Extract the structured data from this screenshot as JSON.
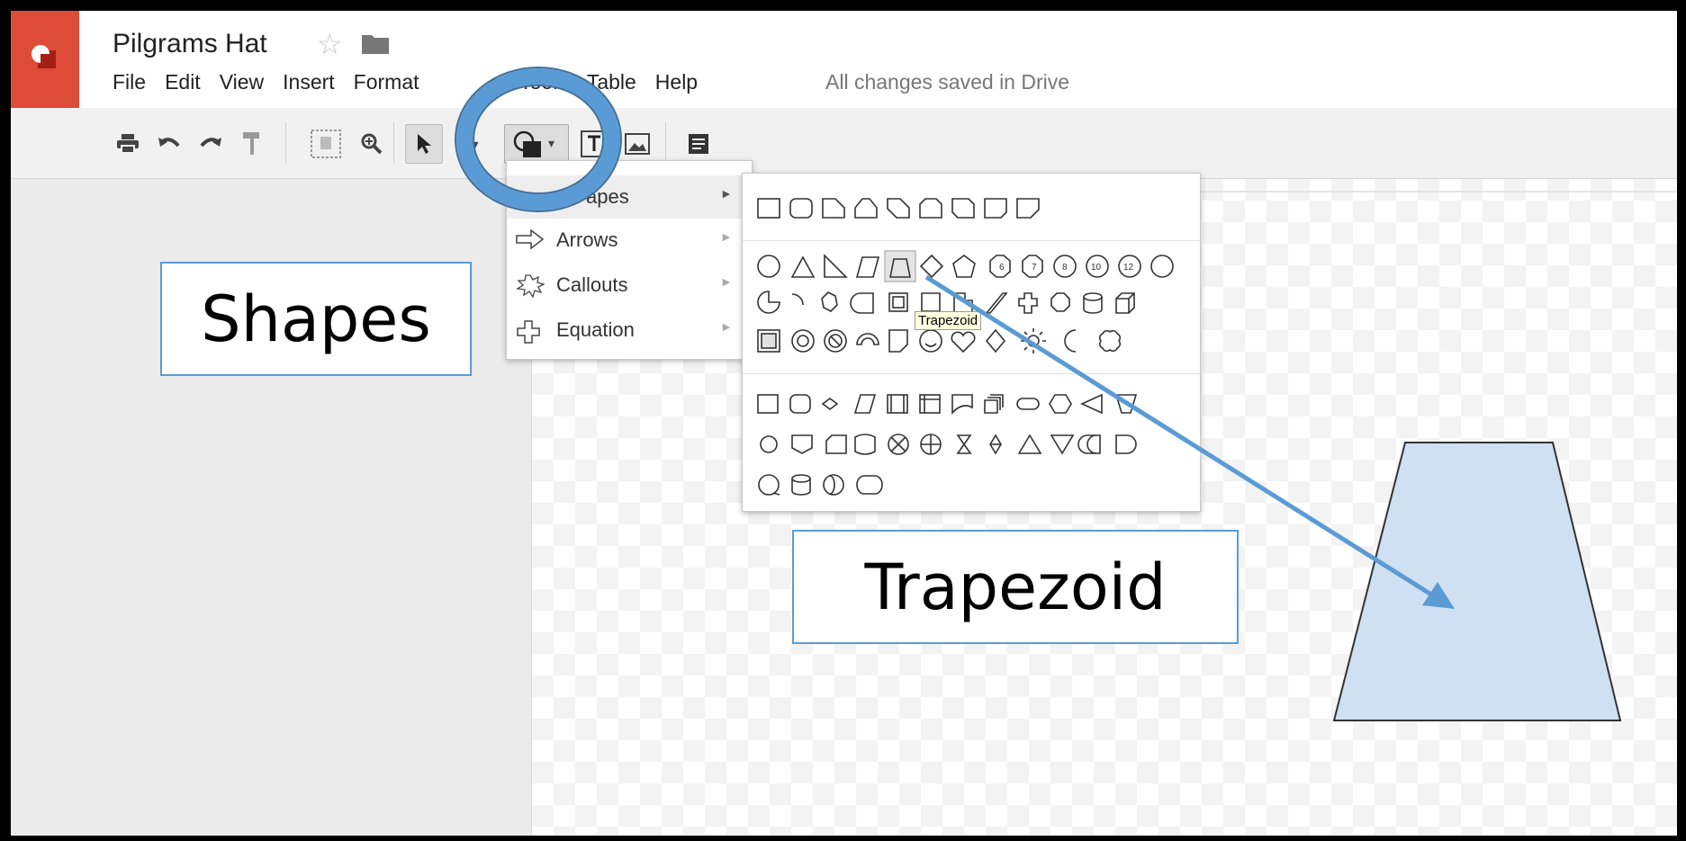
{
  "app": {
    "doc_title": "Pilgrams Hat",
    "saved_status": "All changes saved in Drive",
    "brand_color": "#dd4b39"
  },
  "menubar": {
    "items": [
      "File",
      "Edit",
      "View",
      "Insert",
      "Format",
      "",
      "Tools",
      "Table",
      "Help"
    ],
    "visible_fragments": {
      "arrange": "ge",
      "tools": "Tools"
    }
  },
  "toolbar": {
    "icons": [
      "print-icon",
      "undo-icon",
      "redo-icon",
      "paint-format-icon",
      "fit-icon",
      "zoom-icon",
      "select-icon",
      "line-icon",
      "shape-icon",
      "textbox-icon",
      "image-icon",
      "comment-icon"
    ]
  },
  "shape_menu": {
    "items": [
      {
        "label": "Shapes",
        "visible_label": "apes",
        "icon": "shapes-icon"
      },
      {
        "label": "Arrows",
        "icon": "arrow-icon"
      },
      {
        "label": "Callouts",
        "icon": "callout-icon"
      },
      {
        "label": "Equation",
        "icon": "plus-icon"
      }
    ],
    "arrow_glyph": "►"
  },
  "tooltip": "Trapezoid",
  "annotations": {
    "shapes_label": "Shapes",
    "trapezoid_label": "Trapezoid",
    "accent_color": "#5b9bd5",
    "shape_fill": "#cfe0f3"
  },
  "sub_menu": {
    "glyph_rows": {
      "row3": [
        "⬭",
        "⌒",
        "⬮",
        "◯",
        "▫",
        "◻",
        "⬠",
        "╱",
        "✚",
        "⬡",
        "⛁",
        "⬜"
      ],
      "row4": [
        "▣",
        "◎",
        "⊘",
        "⌓",
        "▭",
        "☺",
        "♡",
        "◇",
        "☼",
        "☾",
        "✺"
      ]
    }
  }
}
